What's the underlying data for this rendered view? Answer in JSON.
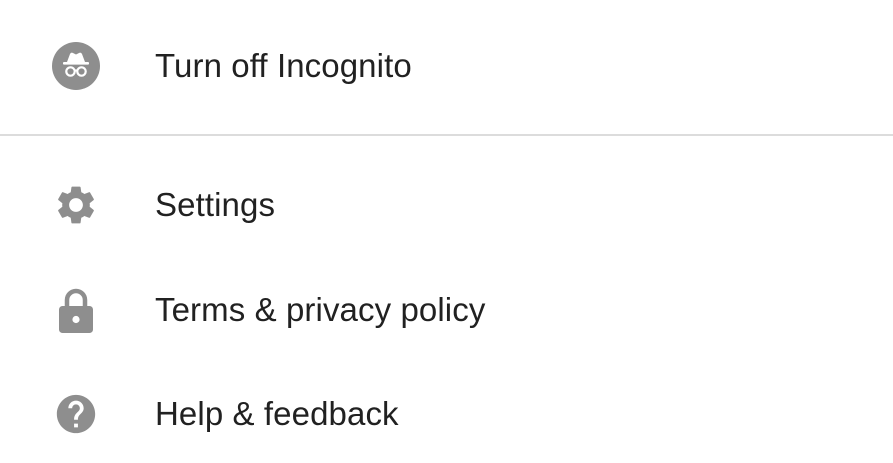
{
  "menu": {
    "incognito": {
      "label": "Turn off Incognito",
      "icon": "incognito-icon"
    },
    "settings": {
      "label": "Settings",
      "icon": "gear-icon"
    },
    "terms": {
      "label": "Terms & privacy policy",
      "icon": "lock-icon"
    },
    "help": {
      "label": "Help & feedback",
      "icon": "help-icon"
    }
  },
  "colors": {
    "icon": "#8e8e8e",
    "text": "#212121",
    "divider": "#dcdcdc",
    "background": "#ffffff"
  }
}
